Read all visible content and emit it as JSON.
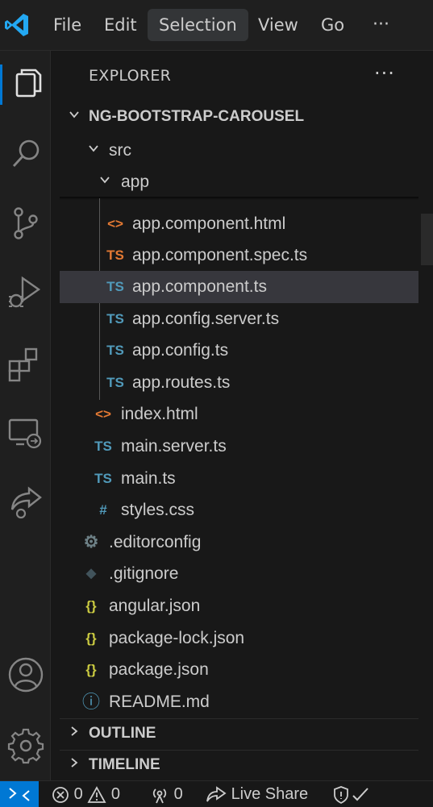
{
  "menu": {
    "items": [
      "File",
      "Edit",
      "Selection",
      "View",
      "Go"
    ],
    "active": "Selection",
    "overflow": "···"
  },
  "sidebar": {
    "header": "EXPLORER",
    "more": "···",
    "project": {
      "label": "NG-BOOTSTRAP-CAROUSEL",
      "chevron": "⌄"
    },
    "folders": {
      "src": "src",
      "app": "app"
    },
    "app_files": [
      {
        "name": "app.component.html",
        "icon": "<>",
        "type": "html"
      },
      {
        "name": "app.component.spec.ts",
        "icon": "TS",
        "type": "tsspec"
      },
      {
        "name": "app.component.ts",
        "icon": "TS",
        "type": "ts",
        "selected": true
      },
      {
        "name": "app.config.server.ts",
        "icon": "TS",
        "type": "ts"
      },
      {
        "name": "app.config.ts",
        "icon": "TS",
        "type": "ts"
      },
      {
        "name": "app.routes.ts",
        "icon": "TS",
        "type": "ts"
      }
    ],
    "src_files": [
      {
        "name": "index.html",
        "icon": "<>",
        "type": "html"
      },
      {
        "name": "main.server.ts",
        "icon": "TS",
        "type": "ts"
      },
      {
        "name": "main.ts",
        "icon": "TS",
        "type": "ts"
      },
      {
        "name": "styles.css",
        "icon": "#",
        "type": "css"
      }
    ],
    "root_files": [
      {
        "name": ".editorconfig",
        "icon": "⚙",
        "type": "gear"
      },
      {
        "name": ".gitignore",
        "icon": "◆",
        "type": "git"
      },
      {
        "name": "angular.json",
        "icon": "{}",
        "type": "json"
      },
      {
        "name": "package-lock.json",
        "icon": "{}",
        "type": "json"
      },
      {
        "name": "package.json",
        "icon": "{}",
        "type": "json"
      },
      {
        "name": "README.md",
        "icon": "ⓘ",
        "type": "info"
      }
    ],
    "outline": "OUTLINE",
    "timeline": "TIMELINE"
  },
  "statusbar": {
    "errors": "0",
    "warnings": "0",
    "ports": "0",
    "live_share": "Live Share"
  },
  "colors": {
    "accent": "#0078d4",
    "background": "#181818",
    "selection": "#37373d"
  }
}
